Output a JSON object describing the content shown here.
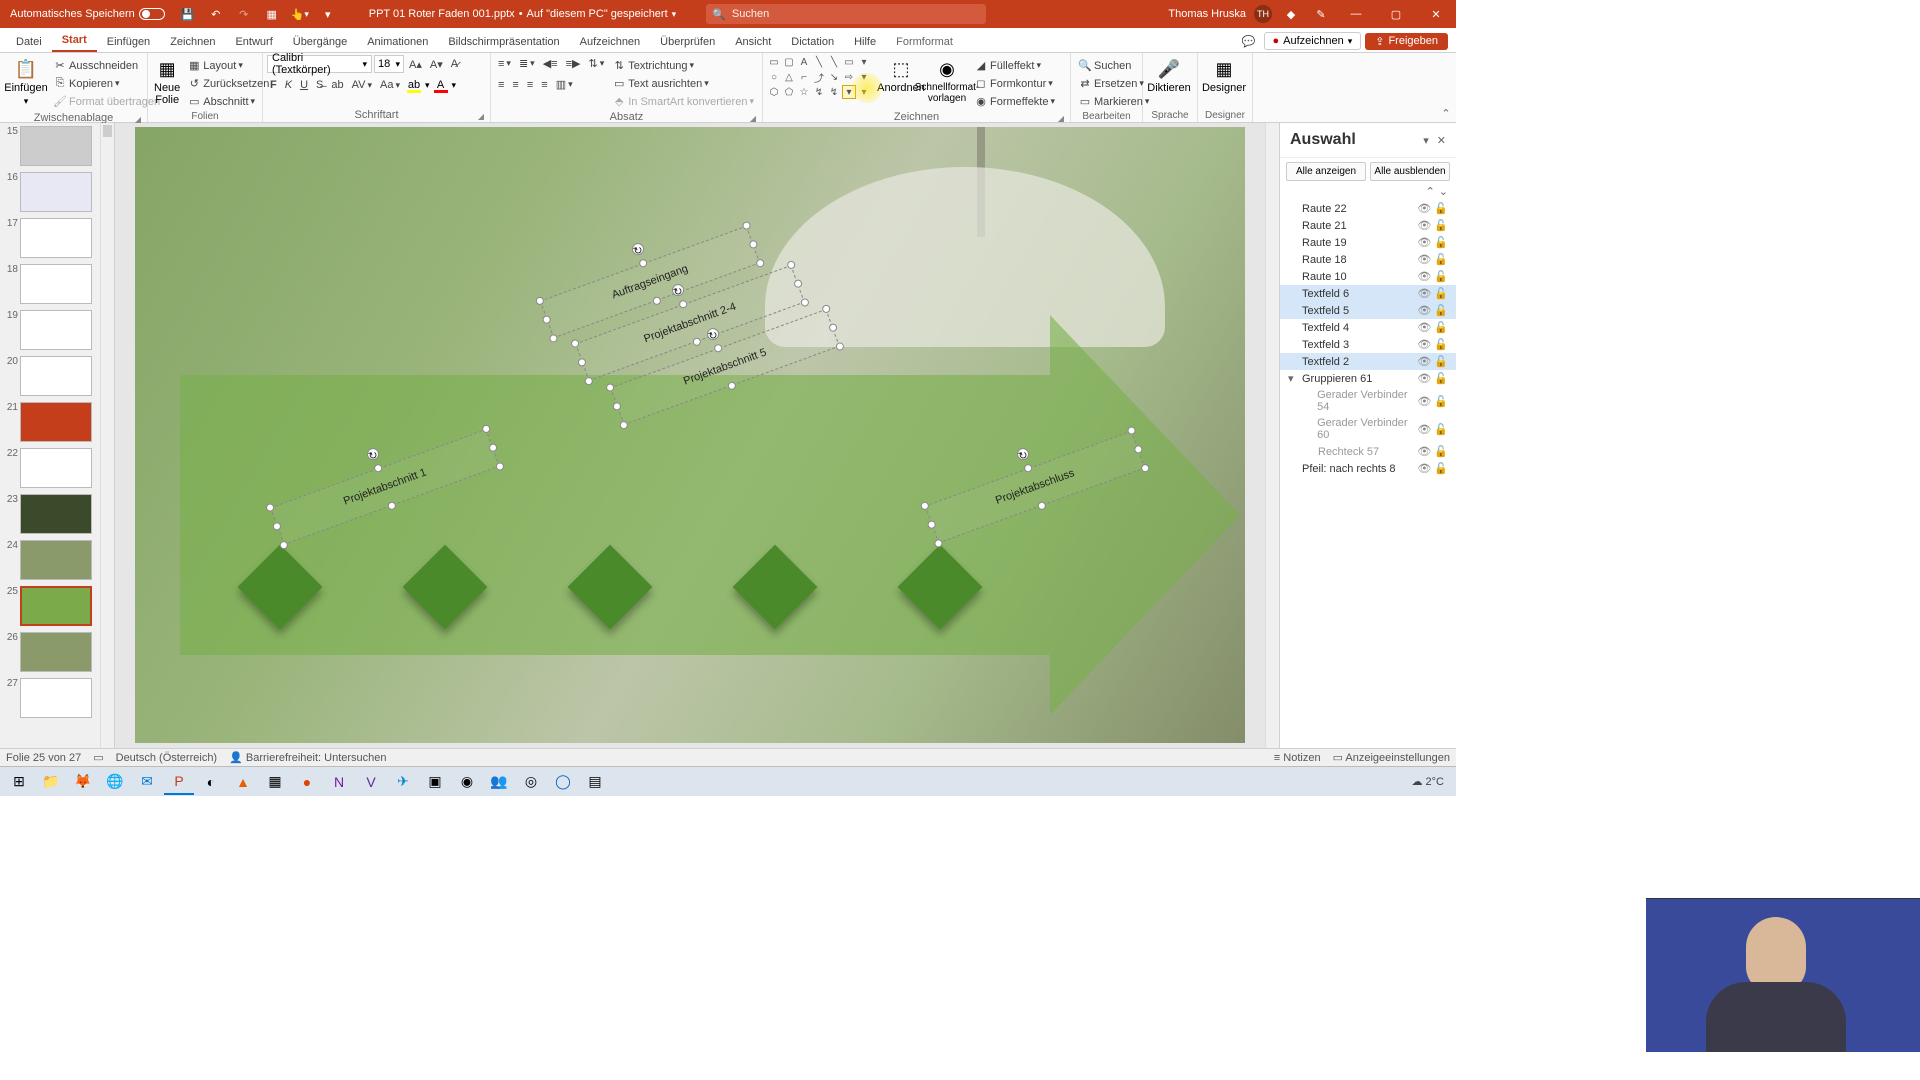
{
  "titlebar": {
    "autosave": "Automatisches Speichern",
    "filename": "PPT 01 Roter Faden 001.pptx",
    "saved_loc": "Auf \"diesem PC\" gespeichert",
    "search_placeholder": "Suchen",
    "user": "Thomas Hruska",
    "user_initials": "TH"
  },
  "tabs": {
    "items": [
      "Datei",
      "Start",
      "Einfügen",
      "Zeichnen",
      "Entwurf",
      "Übergänge",
      "Animationen",
      "Bildschirmpräsentation",
      "Aufzeichnen",
      "Überprüfen",
      "Ansicht",
      "Dictation",
      "Hilfe",
      "Formformat"
    ],
    "active": "Start",
    "record": "Aufzeichnen",
    "share": "Freigeben"
  },
  "ribbon": {
    "clipboard": {
      "paste": "Einfügen",
      "cut": "Ausschneiden",
      "copy": "Kopieren",
      "format_painter": "Format übertragen",
      "label": "Zwischenablage"
    },
    "slides": {
      "new": "Neue\nFolie",
      "layout": "Layout",
      "reset": "Zurücksetzen",
      "section": "Abschnitt",
      "label": "Folien"
    },
    "font": {
      "name": "Calibri (Textkörper)",
      "size": "18",
      "label": "Schriftart"
    },
    "para": {
      "textdir": "Textrichtung",
      "align_text": "Text ausrichten",
      "smartart": "In SmartArt konvertieren",
      "label": "Absatz"
    },
    "draw": {
      "arrange": "Anordnen",
      "quick": "Schnellformat-\nvorlagen",
      "fill": "Fülleffekt",
      "outline": "Formkontur",
      "effects": "Formeffekte",
      "label": "Zeichnen"
    },
    "edit": {
      "find": "Suchen",
      "replace": "Ersetzen",
      "select": "Markieren",
      "label": "Bearbeiten"
    },
    "voice": {
      "dictate": "Diktieren",
      "label": "Sprache"
    },
    "designer": {
      "btn": "Designer",
      "label": "Designer"
    }
  },
  "thumbs": {
    "start": 15,
    "items": [
      15,
      16,
      17,
      18,
      19,
      20,
      21,
      22,
      23,
      24,
      25,
      26,
      27
    ],
    "selected": 25
  },
  "slide": {
    "texts": {
      "auftragseingang": "Auftragseingang",
      "p24": "Projektabschnitt 2-4",
      "p5": "Projektabschnitt 5",
      "p1": "Projektabschnitt 1",
      "abschluss": "Projektabschluss"
    }
  },
  "selpane": {
    "title": "Auswahl",
    "show_all": "Alle anzeigen",
    "hide_all": "Alle ausblenden",
    "items": [
      {
        "name": "Raute 22"
      },
      {
        "name": "Raute 21"
      },
      {
        "name": "Raute 19"
      },
      {
        "name": "Raute 18"
      },
      {
        "name": "Raute 10"
      },
      {
        "name": "Textfeld 6",
        "sel": true
      },
      {
        "name": "Textfeld 5",
        "sel": true
      },
      {
        "name": "Textfeld 4"
      },
      {
        "name": "Textfeld 3"
      },
      {
        "name": "Textfeld 2",
        "sel": true
      },
      {
        "name": "Gruppieren 61",
        "group": true,
        "children": [
          {
            "name": "Gerader Verbinder 54"
          },
          {
            "name": "Gerader Verbinder 60"
          },
          {
            "name": "Rechteck 57"
          }
        ]
      },
      {
        "name": "Pfeil: nach rechts 8"
      }
    ]
  },
  "status": {
    "slide": "Folie 25 von 27",
    "lang": "Deutsch (Österreich)",
    "access": "Barrierefreiheit: Untersuchen",
    "notes": "Notizen",
    "display": "Anzeigeeinstellungen"
  },
  "taskbar": {
    "temp": "2°C"
  }
}
